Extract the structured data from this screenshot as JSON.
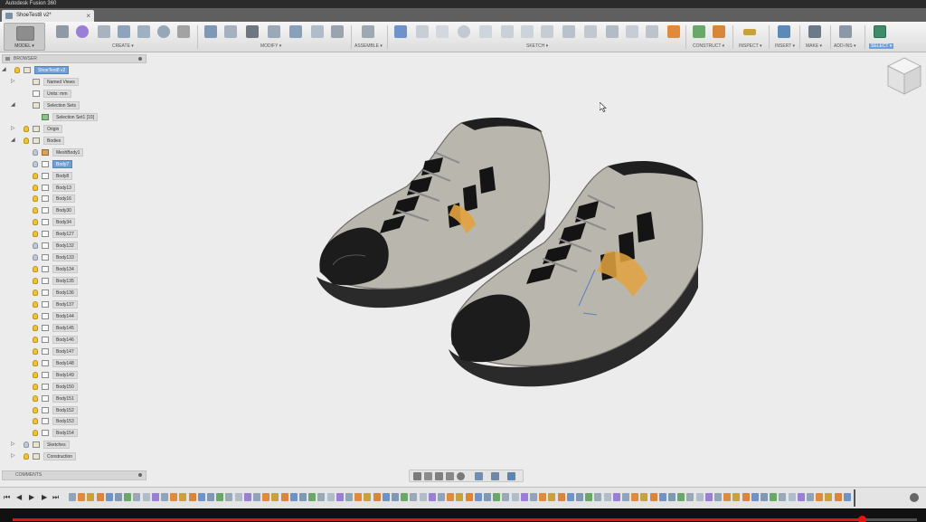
{
  "window": {
    "title": "Autodesk Fusion 360"
  },
  "document_tab": {
    "title": "ShoeTest8 v2*",
    "close": "×"
  },
  "workspace": {
    "label": "MODEL ▾"
  },
  "toolbar": {
    "groups": [
      {
        "label": "CREATE ▾",
        "key": "create"
      },
      {
        "label": "MODIFY ▾",
        "key": "modify"
      },
      {
        "label": "ASSEMBLE ▾",
        "key": "assemble"
      },
      {
        "label": "SKETCH ▾",
        "key": "sketch"
      },
      {
        "label": "CONSTRUCT ▾",
        "key": "construct"
      },
      {
        "label": "INSPECT ▾",
        "key": "inspect"
      },
      {
        "label": "INSERT ▾",
        "key": "insert"
      },
      {
        "label": "MAKE ▾",
        "key": "make"
      },
      {
        "label": "ADD-INS ▾",
        "key": "addins"
      },
      {
        "label": "SELECT ▾",
        "key": "select"
      }
    ]
  },
  "browser": {
    "header": "BROWSER",
    "root": "ShoeTest8 v2",
    "named_views": "Named Views",
    "units": "Units: mm",
    "selection_sets": "Selection Sets",
    "selection_set_1": "Selection Set1 [10]",
    "origin": "Origin",
    "bodies": "Bodies",
    "mesh_body": "MeshBody1",
    "body_items": [
      "Body7",
      "Body8",
      "Body13",
      "Body16",
      "Body30",
      "Body34",
      "Body127",
      "Body132",
      "Body133",
      "Body134",
      "Body135",
      "Body136",
      "Body137",
      "Body144",
      "Body145",
      "Body146",
      "Body147",
      "Body148",
      "Body149",
      "Body150",
      "Body151",
      "Body152",
      "Body153",
      "Body154"
    ],
    "sketches": "Sketches",
    "construction": "Construction"
  },
  "comments": {
    "label": "COMMENTS"
  },
  "colors": {
    "accent": "#6f9fd6",
    "shoe_upper": "#b9b6ae",
    "shoe_dark": "#1c1c1c",
    "highlight": "#e3a23e",
    "progress": "#e11111"
  },
  "player": {
    "progress": 0.94
  }
}
